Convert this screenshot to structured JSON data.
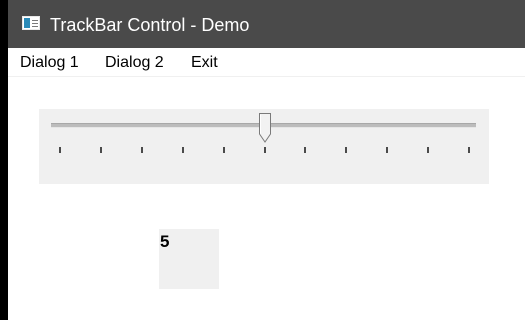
{
  "window": {
    "title": "TrackBar Control - Demo",
    "icon": "app-window-icon"
  },
  "menu": {
    "items": [
      {
        "label": "Dialog 1"
      },
      {
        "label": "Dialog 2"
      },
      {
        "label": "Exit"
      }
    ]
  },
  "trackbar": {
    "min": 0,
    "max": 10,
    "value": 5,
    "tick_count": 11
  },
  "value_display": {
    "text": "5"
  },
  "colors": {
    "titlebar": "#4a4a4a",
    "control_face": "#f0f0f0",
    "background": "#ffffff"
  }
}
